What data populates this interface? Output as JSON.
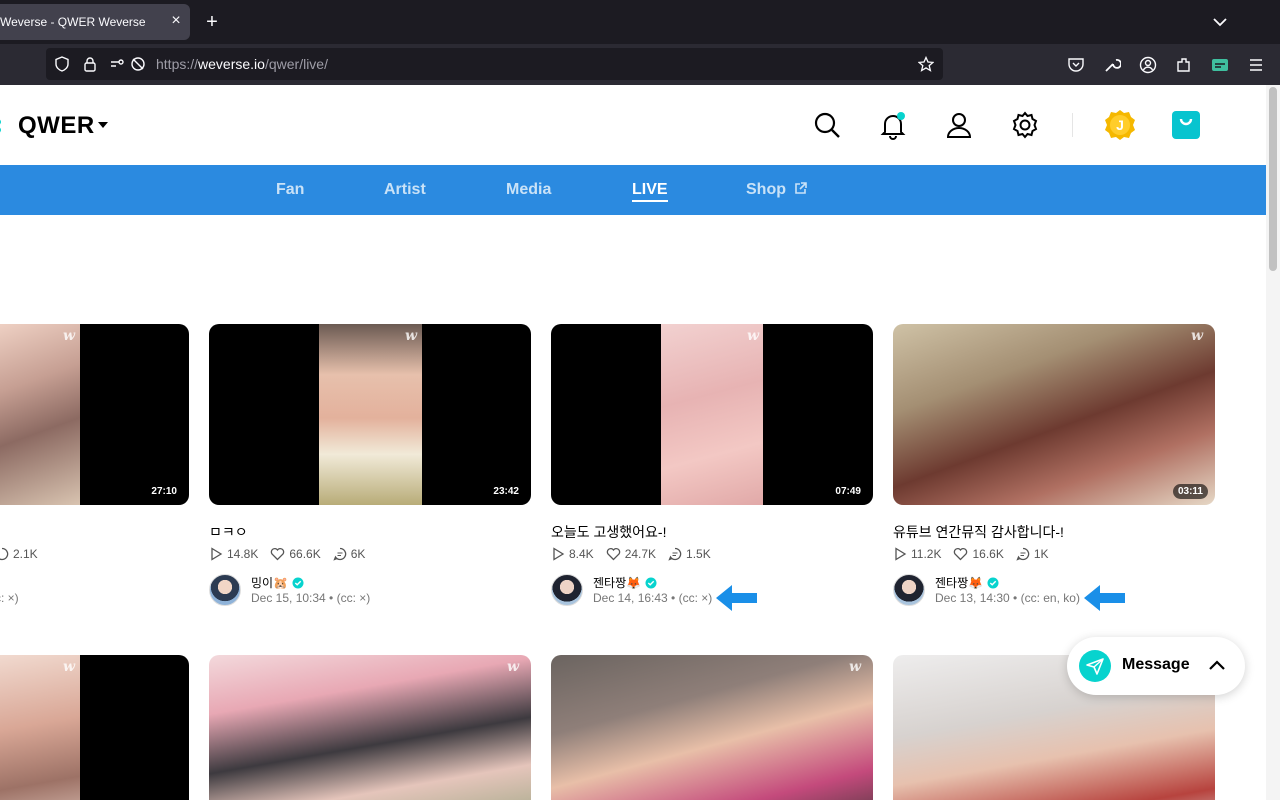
{
  "browser": {
    "tab_title": "Weverse - QWER Weverse",
    "tab_close": "×",
    "new_tab": "+",
    "url_scheme": "https://",
    "url_host": "weverse.io",
    "url_path": "/qwer/live/"
  },
  "header": {
    "artist_name": "QWER",
    "jelly_label": "J"
  },
  "nav": {
    "fan": "Fan",
    "artist": "Artist",
    "media": "Media",
    "live": "LIVE",
    "shop": "Shop"
  },
  "cards": [
    {
      "duration": "27:10",
      "title": "",
      "plays": "",
      "likes": "",
      "comments": "2.1K",
      "author": "",
      "meta": "c: ×)"
    },
    {
      "duration": "23:42",
      "title": "ㅁㅋㅇ",
      "plays": "14.8K",
      "likes": "66.6K",
      "comments": "6K",
      "author": "밍이🐹",
      "meta": "Dec 15, 10:34 • (cc: ×)"
    },
    {
      "duration": "07:49",
      "title": "오늘도 고생했어요-!",
      "plays": "8.4K",
      "likes": "24.7K",
      "comments": "1.5K",
      "author": "젠타짱🦊",
      "meta": "Dec 14, 16:43 • (cc: ×)"
    },
    {
      "duration": "03:11",
      "title": "유튜브 연간뮤직 감사합니다-!",
      "plays": "11.2K",
      "likes": "16.6K",
      "comments": "1K",
      "author": "젠타짱🦊",
      "meta": "Dec 13, 14:30 • (cc: en, ko)"
    }
  ],
  "message": {
    "label": "Message"
  },
  "colors": {
    "nav_blue": "#2b8ae0",
    "accent_teal": "#07d3ce",
    "annotation_arrow": "#1a8fe8"
  }
}
